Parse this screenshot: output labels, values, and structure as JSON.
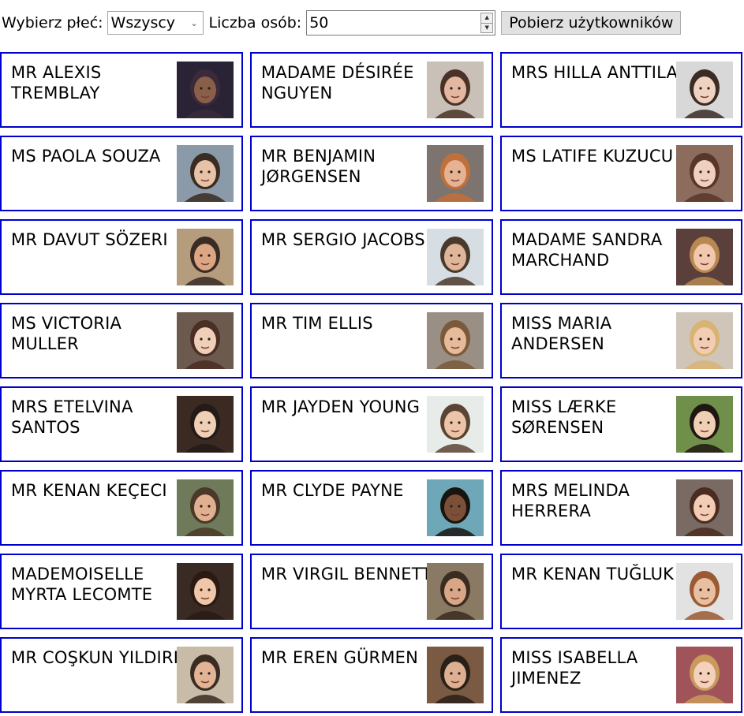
{
  "controls": {
    "gender_label": "Wybierz płeć:",
    "gender_value": "Wszyscy",
    "count_label": "Liczba osób:",
    "count_value": "50",
    "fetch_button": "Pobierz użytkowników"
  },
  "users": [
    {
      "name": "MR ALEXIS TREMBLAY",
      "bg": "#2a2335",
      "skin": "#8a5f4a",
      "hair": "#3a2a3a"
    },
    {
      "name": "MADAME DÉSIRÉE NGUYEN",
      "bg": "#c9c1b8",
      "skin": "#e3b7a0",
      "hair": "#4a3326"
    },
    {
      "name": "MRS HILLA ANTTILA",
      "bg": "#d8d8d8",
      "skin": "#f0d2c3",
      "hair": "#3b2b25"
    },
    {
      "name": "MS PAOLA SOUZA",
      "bg": "#8a9aa8",
      "skin": "#e8c2a6",
      "hair": "#3a2c22"
    },
    {
      "name": "MR BENJAMIN JØRGENSEN",
      "bg": "#7d7470",
      "skin": "#e6b294",
      "hair": "#c0703a"
    },
    {
      "name": "MS LATIFE KUZUCU",
      "bg": "#8c6d5d",
      "skin": "#efd0bf",
      "hair": "#5a3628"
    },
    {
      "name": "MR DAVUT SÖZERI",
      "bg": "#b59c7c",
      "skin": "#dca584",
      "hair": "#3a2c24"
    },
    {
      "name": "MR SERGIO JACOBS",
      "bg": "#d6dde3",
      "skin": "#e0b69a",
      "hair": "#4a3a2c"
    },
    {
      "name": "MADAME SANDRA MARCHAND",
      "bg": "#5a3f3a",
      "skin": "#f1c7ad",
      "hair": "#b88852"
    },
    {
      "name": "MS VICTORIA MULLER",
      "bg": "#6d5a4e",
      "skin": "#efcfb8",
      "hair": "#4b2e25"
    },
    {
      "name": "MR TIM ELLIS",
      "bg": "#9a8f84",
      "skin": "#e6bb9b",
      "hair": "#7a5a3a"
    },
    {
      "name": "MISS MARIA ANDERSEN",
      "bg": "#cfc5b9",
      "skin": "#f2cdb3",
      "hair": "#d8b474"
    },
    {
      "name": "MRS ETELVINA SANTOS",
      "bg": "#3a2a22",
      "skin": "#efcfb6",
      "hair": "#241a16"
    },
    {
      "name": "MR JAYDEN YOUNG",
      "bg": "#e8ece8",
      "skin": "#ecc4a8",
      "hair": "#5a4434"
    },
    {
      "name": "MISS LÆRKE SØRENSEN",
      "bg": "#6f8f4a",
      "skin": "#f0d0b5",
      "hair": "#1f1712"
    },
    {
      "name": "MR KENAN KEÇECI",
      "bg": "#6f7a5a",
      "skin": "#e0b191",
      "hair": "#4a3828"
    },
    {
      "name": "MR CLYDE PAYNE",
      "bg": "#6ea8b8",
      "skin": "#7a5038",
      "hair": "#1a1410"
    },
    {
      "name": "MRS MELINDA HERRERA",
      "bg": "#7a6a64",
      "skin": "#f3ccb5",
      "hair": "#4a2c20"
    },
    {
      "name": "MADEMOISELLE MYRTA LECOMTE",
      "bg": "#3a2a24",
      "skin": "#f0c6a9",
      "hair": "#2a1a14"
    },
    {
      "name": "MR VIRGIL BENNETT",
      "bg": "#8a7a64",
      "skin": "#d9a787",
      "hair": "#3a2c20"
    },
    {
      "name": "MR KENAN TUĞLUK",
      "bg": "#e2e2e2",
      "skin": "#e9bfa1",
      "hair": "#9a5a32"
    },
    {
      "name": "MR COŞKUN YILDIRIM",
      "bg": "#c8bca8",
      "skin": "#e3b396",
      "hair": "#3a2c22"
    },
    {
      "name": "MR EREN GÜRMEN",
      "bg": "#7a5a42",
      "skin": "#ddb092",
      "hair": "#2a2018"
    },
    {
      "name": "MISS ISABELLA JIMENEZ",
      "bg": "#a0545a",
      "skin": "#f3d1bb",
      "hair": "#c89a5c"
    }
  ]
}
